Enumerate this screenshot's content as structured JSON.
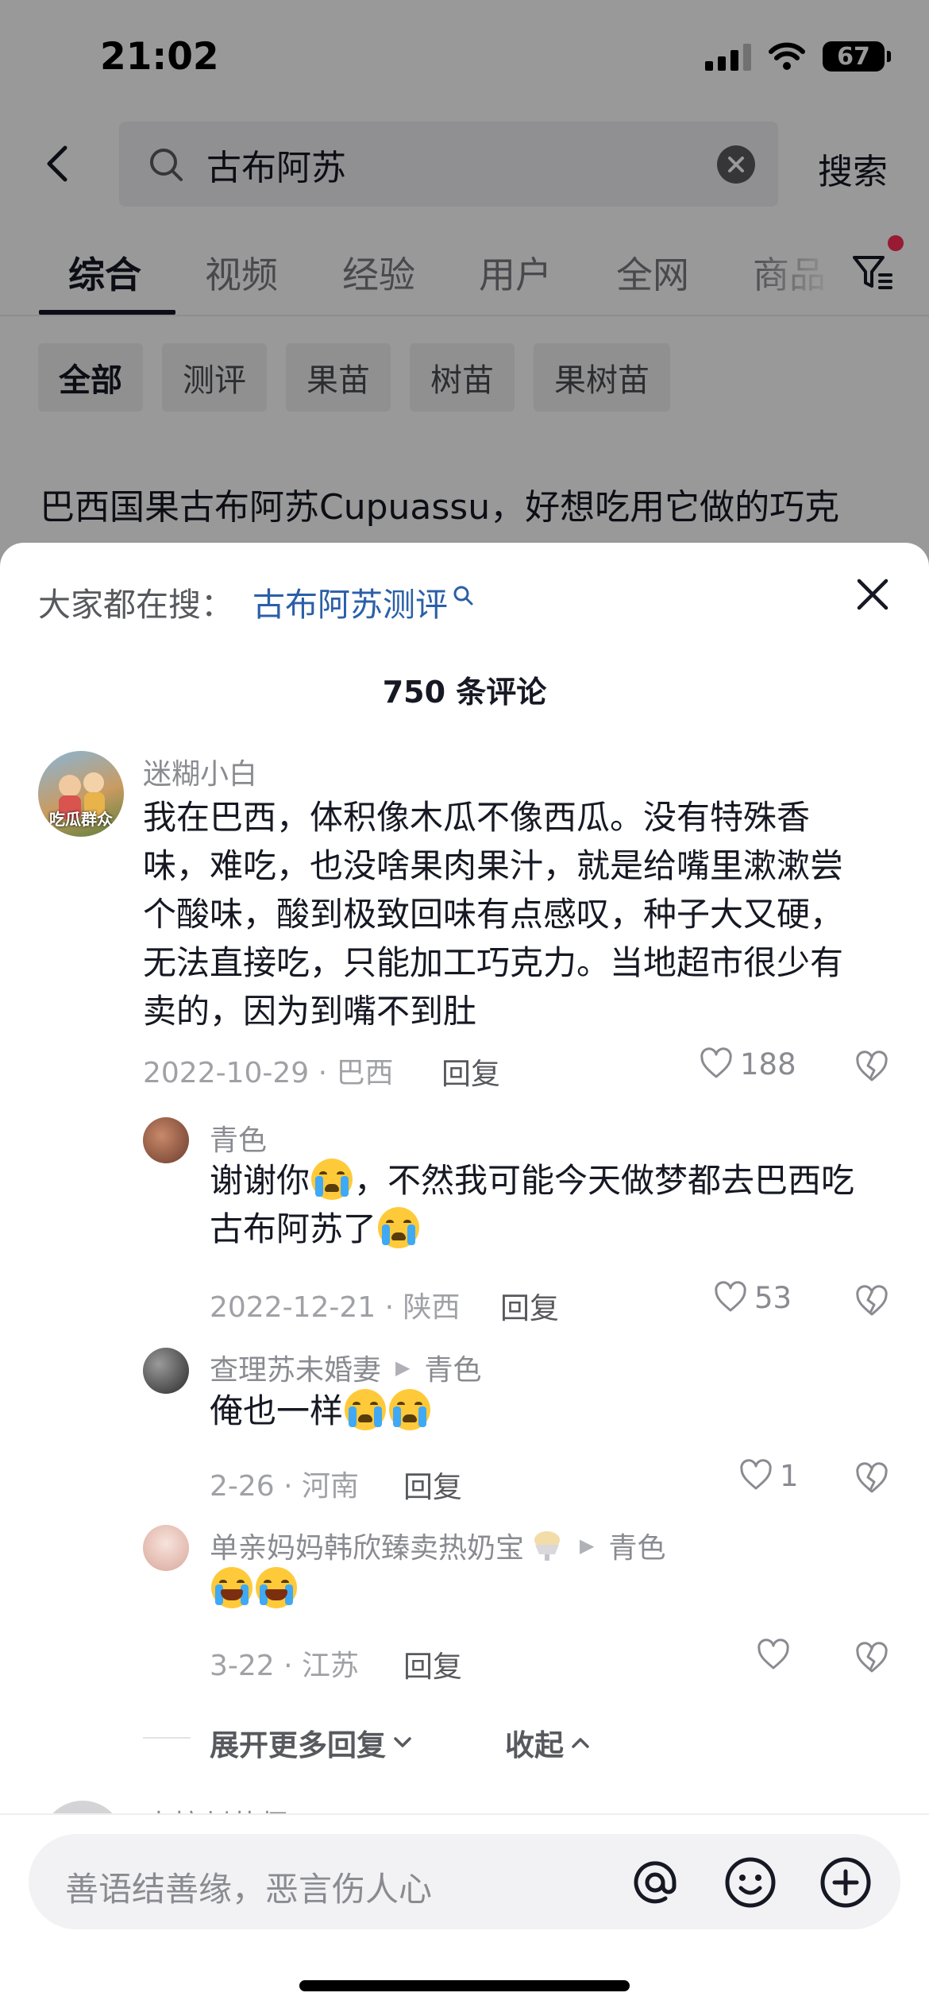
{
  "status_bar": {
    "time": "21:02",
    "battery": "67"
  },
  "search": {
    "query": "古布阿苏",
    "search_button": "搜索"
  },
  "tabs": [
    "综合",
    "视频",
    "经验",
    "用户",
    "全网",
    "商品"
  ],
  "filter_chips": [
    "全部",
    "测评",
    "果苗",
    "树苗",
    "果树苗"
  ],
  "background_post": {
    "description": "巴西国果古布阿苏Cupuassu，好想吃用它做的巧克"
  },
  "comments_sheet": {
    "hot_search_label": "大家都在搜：",
    "hot_search_term": "古布阿苏测评",
    "count_text": "750 条评论",
    "comments": [
      {
        "user": "迷糊小白",
        "avatar_text": "吃瓜群众",
        "text": "我在巴西，体积像木瓜不像西瓜。没有特殊香味，难吃，也没啥果肉果汁，就是给嘴里漱漱尝个酸味，酸到极致回味有点感叹，种子大又硬，无法直接吃，只能加工巧克力。当地超市很少有卖的，因为到嘴不到肚",
        "meta": "2022-10-29 · 巴西",
        "reply": "回复",
        "likes": "188"
      },
      {
        "user": "青色",
        "text_part1": "谢谢你",
        "text_part2": "，不然我可能今天做梦都去巴西吃古布阿苏了",
        "meta": "2022-12-21 · 陕西",
        "reply": "回复",
        "likes": "53"
      },
      {
        "user": "查理苏未婚妻",
        "reply_to": "青色",
        "text": "俺也一样",
        "meta": "2-26 · 河南",
        "reply": "回复",
        "likes": "1"
      },
      {
        "user": "单亲妈妈韩欣臻卖热奶宝",
        "reply_to": "青色",
        "meta": "3-22 · 江苏",
        "reply": "回复"
      }
    ],
    "expand_more": "展开更多回复",
    "collapse": "收起",
    "next_user": "李拉刺若师"
  },
  "input": {
    "placeholder": "善语结善缘，恶言伤人心"
  }
}
